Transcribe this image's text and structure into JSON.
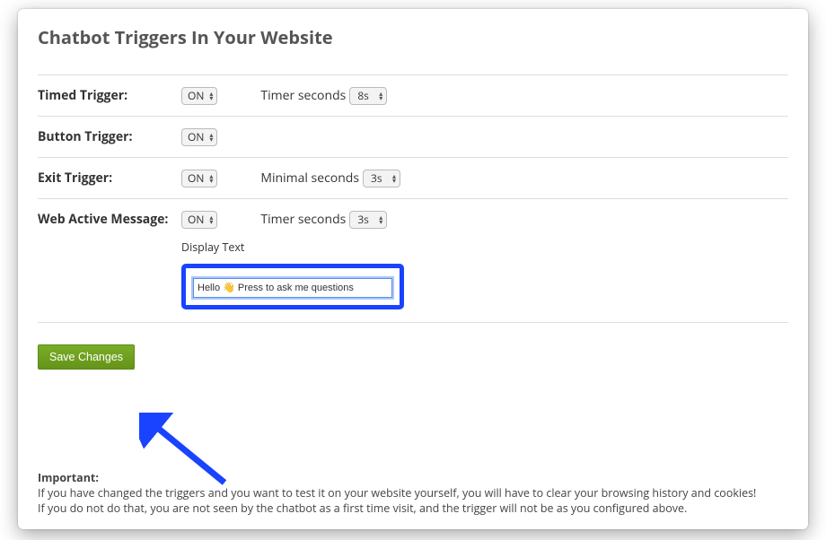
{
  "title": "Chatbot Triggers In Your Website",
  "rows": {
    "timed": {
      "label": "Timed Trigger:",
      "toggle": "ON",
      "sub_label": "Timer seconds",
      "sub_value": "8s"
    },
    "button": {
      "label": "Button Trigger:",
      "toggle": "ON"
    },
    "exit": {
      "label": "Exit Trigger:",
      "toggle": "ON",
      "sub_label": "Minimal seconds",
      "sub_value": "3s"
    },
    "active": {
      "label": "Web Active Message:",
      "toggle": "ON",
      "sub_label": "Timer seconds",
      "sub_value": "3s"
    }
  },
  "display_text_label": "Display Text",
  "display_text_value": "Hello 👋 Press to ask me questions",
  "save_label": "Save Changes",
  "important": {
    "heading": "Important:",
    "line1": "If you have changed the triggers and you want to test it on your website yourself, you will have to clear your browsing history and cookies!",
    "line2": "If you do not do that, you are not seen by the chatbot as a first time visit, and the trigger will not be as you configured above."
  }
}
